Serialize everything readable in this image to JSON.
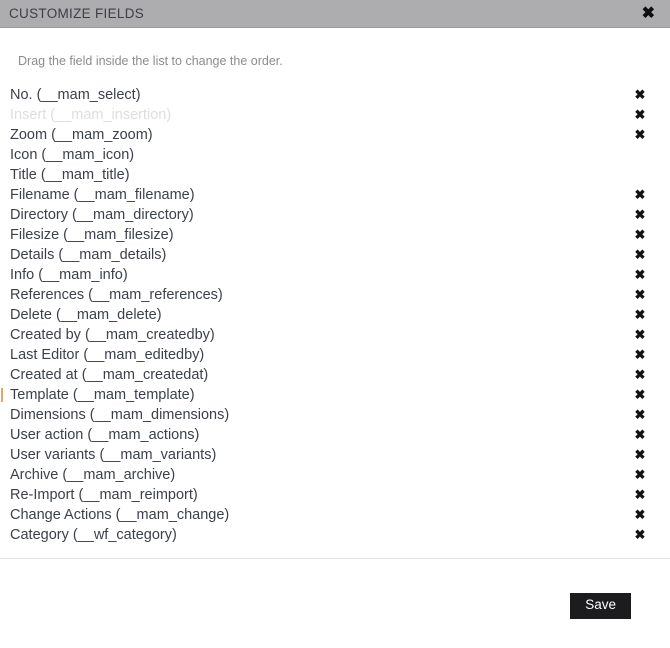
{
  "dialog": {
    "title": "CUSTOMIZE FIELDS",
    "close_icon": "close-icon",
    "close_glyph": "✖",
    "hint": "Drag the field inside the list to change the order."
  },
  "colors": {
    "titlebar_bg": "#adadaf",
    "titlebar_text": "#3b3f46",
    "body_bg": "#ffffff",
    "label_text": "#3c4149",
    "disabled_text": "#dedede",
    "hint_text": "#8c8c8c",
    "save_bg": "#1c1c1e",
    "save_text": "#ffffff",
    "divider": "#e4e4e4",
    "drag_marker": "#d79a4a"
  },
  "fields": [
    {
      "label": "No. (__mam_select)",
      "removable": true,
      "disabled": false,
      "marker": false
    },
    {
      "label": "Insert (__mam_insertion)",
      "removable": true,
      "disabled": true,
      "marker": false
    },
    {
      "label": "Zoom (__mam_zoom)",
      "removable": true,
      "disabled": false,
      "marker": false
    },
    {
      "label": "Icon (__mam_icon)",
      "removable": false,
      "disabled": false,
      "marker": false
    },
    {
      "label": "Title (__mam_title)",
      "removable": false,
      "disabled": false,
      "marker": false
    },
    {
      "label": "Filename (__mam_filename)",
      "removable": true,
      "disabled": false,
      "marker": false
    },
    {
      "label": "Directory (__mam_directory)",
      "removable": true,
      "disabled": false,
      "marker": false
    },
    {
      "label": "Filesize (__mam_filesize)",
      "removable": true,
      "disabled": false,
      "marker": false
    },
    {
      "label": "Details (__mam_details)",
      "removable": true,
      "disabled": false,
      "marker": false
    },
    {
      "label": "Info (__mam_info)",
      "removable": true,
      "disabled": false,
      "marker": false
    },
    {
      "label": "References (__mam_references)",
      "removable": true,
      "disabled": false,
      "marker": false
    },
    {
      "label": "Delete (__mam_delete)",
      "removable": true,
      "disabled": false,
      "marker": false
    },
    {
      "label": "Created by (__mam_createdby)",
      "removable": true,
      "disabled": false,
      "marker": false
    },
    {
      "label": "Last Editor (__mam_editedby)",
      "removable": true,
      "disabled": false,
      "marker": false
    },
    {
      "label": "Created at (__mam_createdat)",
      "removable": true,
      "disabled": false,
      "marker": false
    },
    {
      "label": "Template (__mam_template)",
      "removable": true,
      "disabled": false,
      "marker": true
    },
    {
      "label": "Dimensions (__mam_dimensions)",
      "removable": true,
      "disabled": false,
      "marker": false
    },
    {
      "label": "User action (__mam_actions)",
      "removable": true,
      "disabled": false,
      "marker": false
    },
    {
      "label": "User variants (__mam_variants)",
      "removable": true,
      "disabled": false,
      "marker": false
    },
    {
      "label": "Archive (__mam_archive)",
      "removable": true,
      "disabled": false,
      "marker": false
    },
    {
      "label": "Re-Import (__mam_reimport)",
      "removable": true,
      "disabled": false,
      "marker": false
    },
    {
      "label": "Change Actions (__mam_change)",
      "removable": true,
      "disabled": false,
      "marker": false
    },
    {
      "label": "Category (__wf_category)",
      "removable": true,
      "disabled": false,
      "marker": false
    }
  ],
  "remove_glyph": "✖",
  "footer": {
    "save_label": "Save"
  }
}
